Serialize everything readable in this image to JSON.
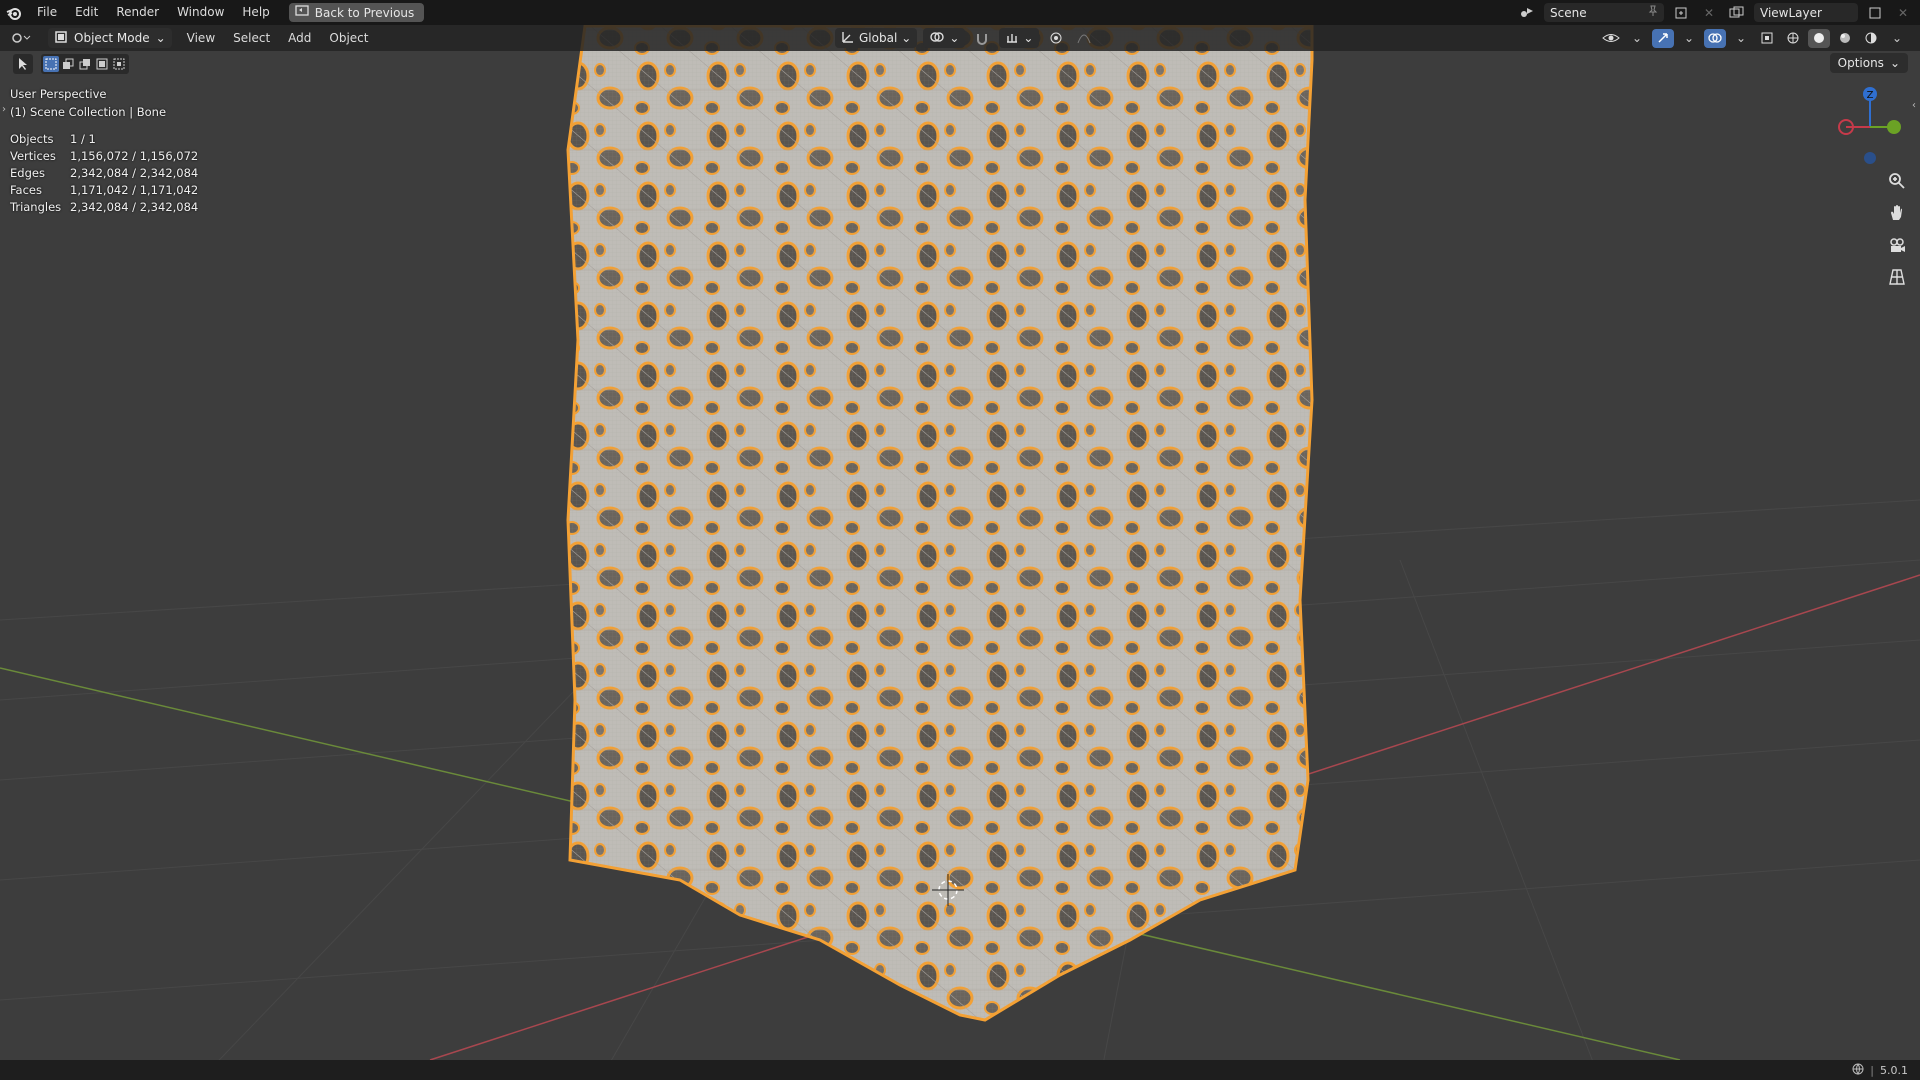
{
  "topbar": {
    "menu": [
      "File",
      "Edit",
      "Render",
      "Window",
      "Help"
    ],
    "back_button": "Back to Previous",
    "scene": "Scene",
    "view_layer": "ViewLayer"
  },
  "header": {
    "mode": "Object Mode",
    "menu": [
      "View",
      "Select",
      "Add",
      "Object"
    ],
    "transform_orientation": "Global",
    "options_label": "Options"
  },
  "viewport": {
    "perspective": "User Perspective",
    "collection": "(1) Scene Collection | Bone"
  },
  "stats": [
    {
      "label": "Objects",
      "value": "1 / 1"
    },
    {
      "label": "Vertices",
      "value": "1,156,072 / 1,156,072"
    },
    {
      "label": "Edges",
      "value": "2,342,084 / 2,342,084"
    },
    {
      "label": "Faces",
      "value": "1,171,042 / 1,171,042"
    },
    {
      "label": "Triangles",
      "value": "2,342,084 / 2,342,084"
    }
  ],
  "gizmo": {
    "z_label": "Z"
  },
  "footer": {
    "version": "5.0.1"
  },
  "colors": {
    "selection_outline": "#f5a133",
    "mesh": "#bdbdbd",
    "x_axis": "#a8474f",
    "y_axis": "#6a8a3a"
  }
}
